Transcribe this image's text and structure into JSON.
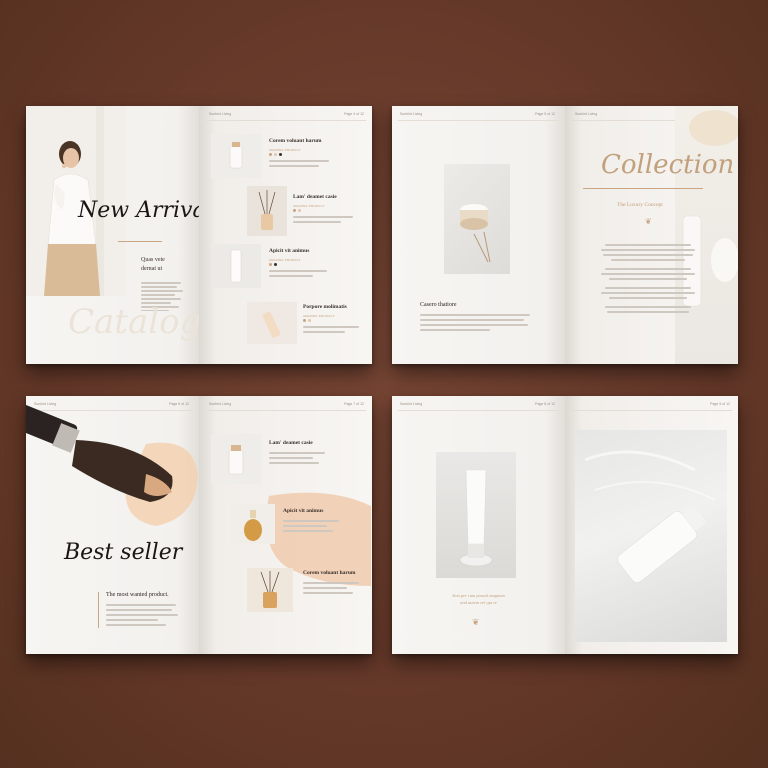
{
  "mockup": {
    "spread1": {
      "left": {
        "header": "Sunbird Living",
        "title": "New Arrivals",
        "subtitle_lines": [
          "Quas veie",
          "dernat ut"
        ],
        "watermark": "Catalogue"
      },
      "right": {
        "header_left": "Sunbird Living",
        "header_right": "Page 4 of 12",
        "products": [
          {
            "name": "Corem voluant harum",
            "label": "AMAZING PRODUCT"
          },
          {
            "name": "Lam' deamet casie",
            "label": "AMAZING PRODUCT"
          },
          {
            "name": "Apicit vit animus",
            "label": "AMAZING PRODUCT"
          },
          {
            "name": "Porpore molimatis",
            "label": "AMAZING PRODUCT"
          }
        ]
      }
    },
    "spread2": {
      "left": {
        "header_left": "Sunbird Living",
        "header_right": "Page 5 of 12",
        "heading": "Casero thatiore"
      },
      "right": {
        "header": "Sunbird Living",
        "title": "Collection",
        "subtitle": "The Luxury Concept"
      }
    },
    "spread3": {
      "left": {
        "header_left": "Sunbird Living",
        "header_right": "Page 6 of 12",
        "title": "Best seller",
        "tagline": "The most wanted product."
      },
      "right": {
        "header_left": "Sunbird Living",
        "header_right": "Page 7 of 12",
        "products": [
          {
            "name": "Lam' deamet casie"
          },
          {
            "name": "Apicit vit animus"
          },
          {
            "name": "Corem voluant harum"
          }
        ]
      }
    },
    "spread4": {
      "left": {
        "header_left": "Sunbird Living",
        "header_right": "Page 8 of 12",
        "quote_lines": [
          "Sem per rum possiti magnam",
          "and autem vel qui re"
        ]
      },
      "right": {
        "header_right": "Page 9 of 12"
      }
    }
  },
  "colors": {
    "background": "#6b3f2e",
    "paper": "#f7f5f2",
    "accent_gold": "#c9a582",
    "ink": "#1b1614"
  }
}
